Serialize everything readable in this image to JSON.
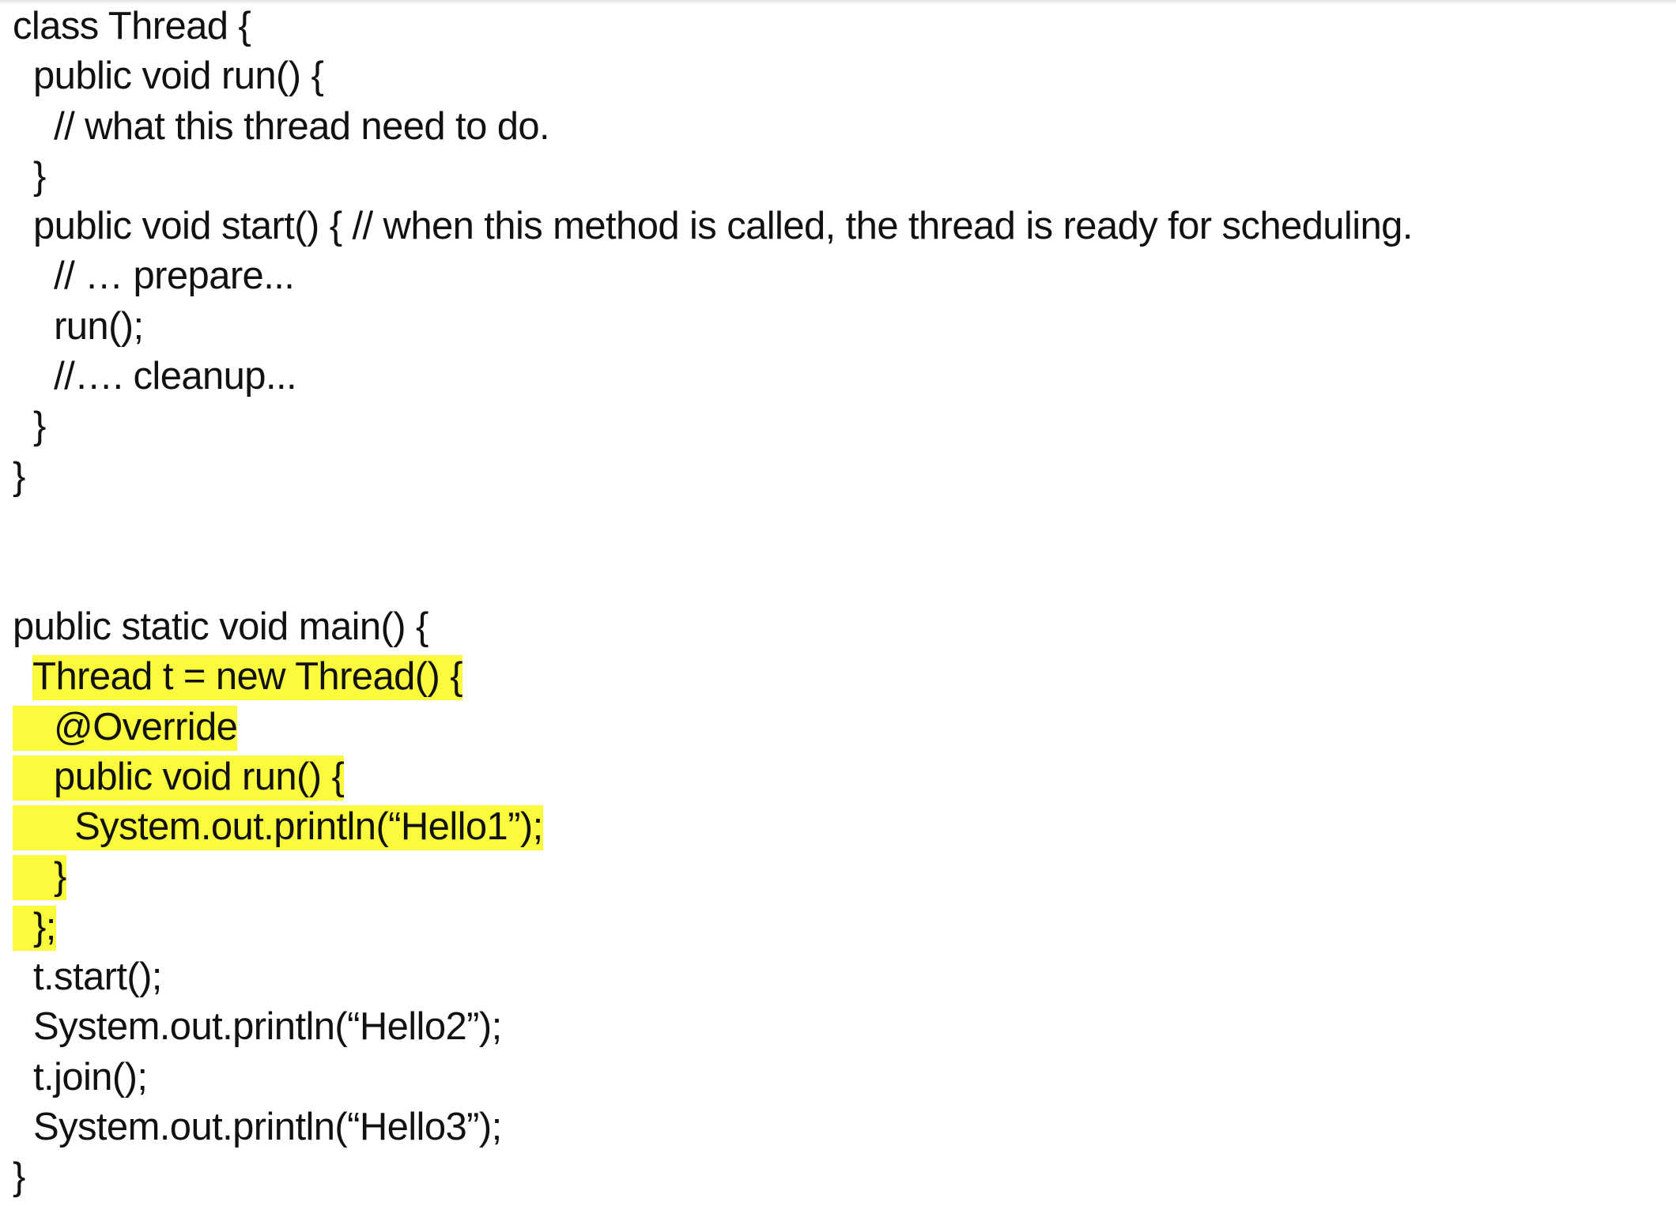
{
  "document": {
    "class_block": [
      {
        "indent": "",
        "text": "class Thread {"
      },
      {
        "indent": "  ",
        "text": "public void run() {"
      },
      {
        "indent": "    ",
        "text": "// what this thread need to do."
      },
      {
        "indent": "  ",
        "text": "}"
      },
      {
        "indent": "  ",
        "text": "public void start() { // when this method is called, the thread is ready for scheduling."
      },
      {
        "indent": "    ",
        "text": "// … prepare..."
      },
      {
        "indent": "    ",
        "text": "run();"
      },
      {
        "indent": "    ",
        "text": "//…. cleanup..."
      },
      {
        "indent": "  ",
        "text": "}"
      },
      {
        "indent": "",
        "text": "}"
      }
    ],
    "main_block": [
      {
        "indent": "",
        "text": "public static void main() {",
        "highlight": false
      },
      {
        "indent": "  ",
        "text": "Thread t = new Thread() {",
        "highlight": true
      },
      {
        "indent": "",
        "text": "    @Override",
        "highlight": true
      },
      {
        "indent": "",
        "text": "    public void run() {",
        "highlight": true
      },
      {
        "indent": "",
        "text": "      System.out.println(“Hello1”);",
        "highlight": true
      },
      {
        "indent": "",
        "text": "    }",
        "highlight": true
      },
      {
        "indent": "",
        "text": "  };",
        "highlight": true
      },
      {
        "indent": "  ",
        "text": "t.start();",
        "highlight": false
      },
      {
        "indent": "  ",
        "text": "System.out.println(“Hello2”);",
        "highlight": false
      },
      {
        "indent": "  ",
        "text": "t.join();",
        "highlight": false
      },
      {
        "indent": "  ",
        "text": "System.out.println(“Hello3”);",
        "highlight": false
      },
      {
        "indent": "",
        "text": "}",
        "highlight": false
      }
    ],
    "highlight_color": "#fbfb3e",
    "text_color": "#111111"
  }
}
